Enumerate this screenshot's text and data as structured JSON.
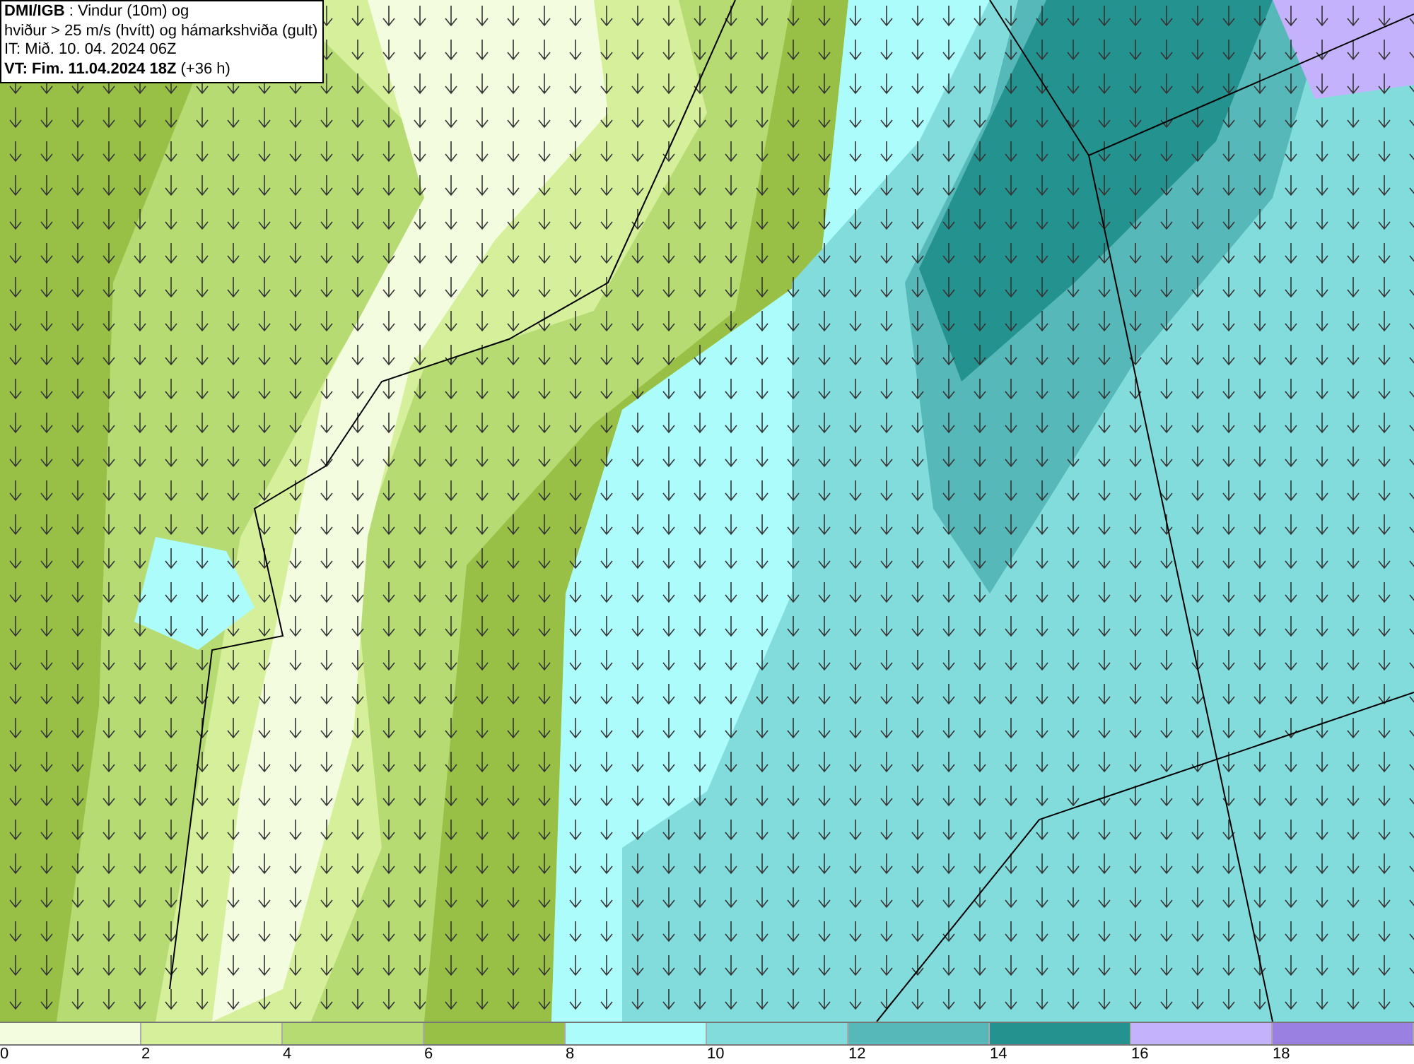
{
  "header": {
    "lines": [
      "**DMI/IGB** : Vindur (10m) og",
      "hviður > 25 m/s (hvítt) og hámarkshviða (gult)",
      "IT: Mið. 10. 04. 2024 06Z",
      "**VT: Fim. 11.04.2024 18Z** (+36 h)"
    ]
  },
  "legend": {
    "bins": [
      {
        "color": "#f4fce0"
      },
      {
        "color": "#d5ef9a"
      },
      {
        "color": "#b5db72"
      },
      {
        "color": "#98c046"
      },
      {
        "color": "#adfcfc"
      },
      {
        "color": "#82dcdc"
      },
      {
        "color": "#56b8b8"
      },
      {
        "color": "#24938f"
      },
      {
        "color": "#c4b3fc"
      },
      {
        "color": "#9a80e0"
      }
    ],
    "ticks": [
      "0",
      "2",
      "4",
      "6",
      "8",
      "10",
      "12",
      "14",
      "16",
      "18"
    ]
  }
}
